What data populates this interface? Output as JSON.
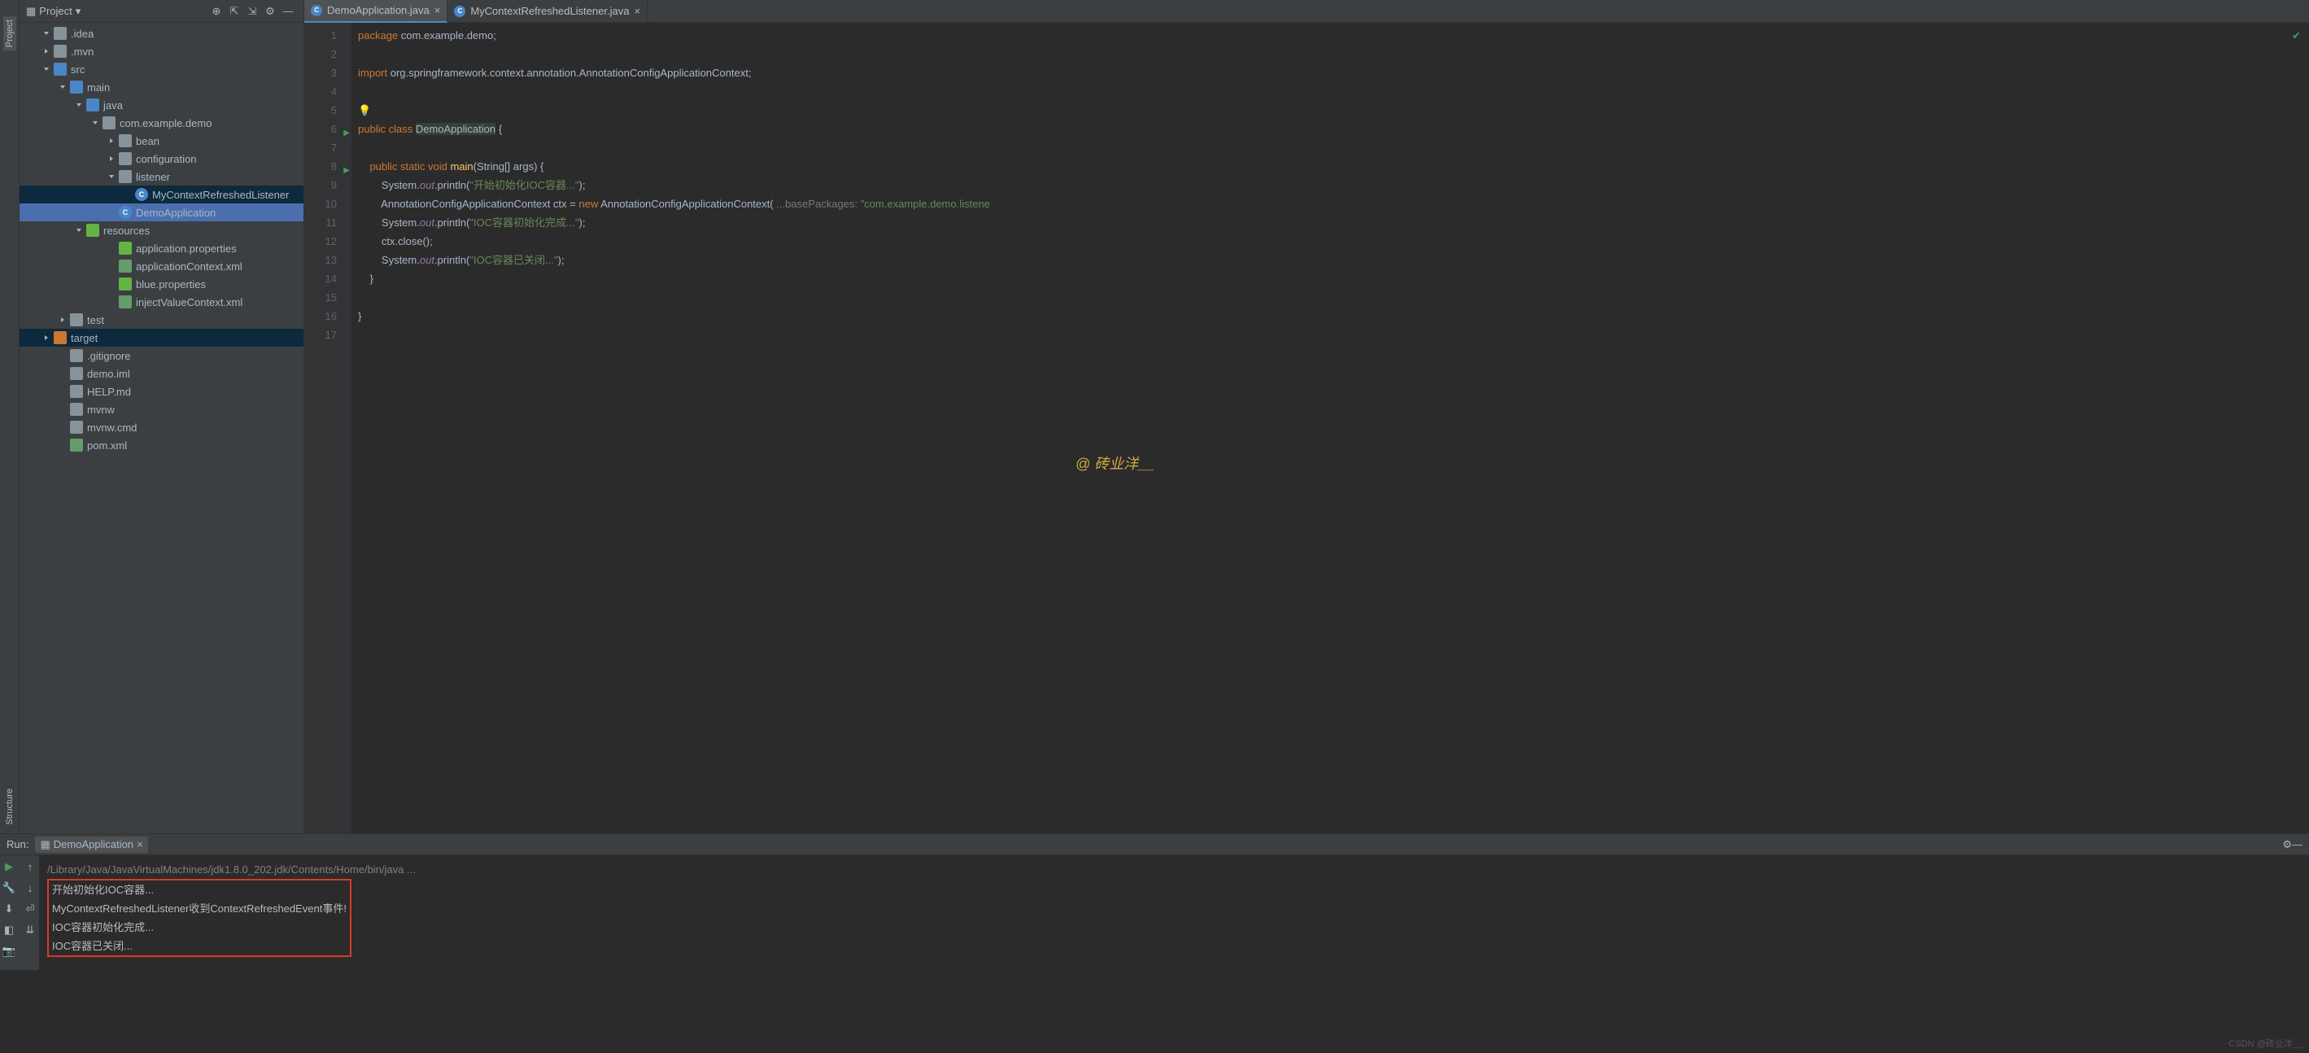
{
  "leftTabs": {
    "project": "Project",
    "structure": "Structure"
  },
  "sidebar": {
    "title": "Project",
    "tree": [
      {
        "indent": 28,
        "chv": "d",
        "ico": "folder",
        "name": ".idea"
      },
      {
        "indent": 28,
        "chv": "r",
        "ico": "folder",
        "name": ".mvn"
      },
      {
        "indent": 28,
        "chv": "d",
        "ico": "folder-src",
        "name": "src"
      },
      {
        "indent": 48,
        "chv": "d",
        "ico": "folder-src",
        "name": "main"
      },
      {
        "indent": 68,
        "chv": "d",
        "ico": "folder-src",
        "name": "java"
      },
      {
        "indent": 88,
        "chv": "d",
        "ico": "folder",
        "name": "com.example.demo"
      },
      {
        "indent": 108,
        "chv": "r",
        "ico": "folder",
        "name": "bean"
      },
      {
        "indent": 108,
        "chv": "r",
        "ico": "folder",
        "name": "configuration"
      },
      {
        "indent": 108,
        "chv": "d",
        "ico": "folder",
        "name": "listener"
      },
      {
        "indent": 128,
        "chv": "",
        "ico": "cls",
        "name": "MyContextRefreshedListener",
        "sel": true
      },
      {
        "indent": 108,
        "chv": "",
        "ico": "cls",
        "name": "DemoApplication",
        "hl": true
      },
      {
        "indent": 68,
        "chv": "d",
        "ico": "folder-res",
        "name": "resources"
      },
      {
        "indent": 108,
        "chv": "",
        "ico": "prop",
        "name": "application.properties"
      },
      {
        "indent": 108,
        "chv": "",
        "ico": "xml",
        "name": "applicationContext.xml"
      },
      {
        "indent": 108,
        "chv": "",
        "ico": "prop",
        "name": "blue.properties"
      },
      {
        "indent": 108,
        "chv": "",
        "ico": "xml",
        "name": "injectValueContext.xml"
      },
      {
        "indent": 48,
        "chv": "r",
        "ico": "folder",
        "name": "test"
      },
      {
        "indent": 28,
        "chv": "r",
        "ico": "folder-tgt",
        "name": "target",
        "sel": true
      },
      {
        "indent": 48,
        "chv": "",
        "ico": "file",
        "name": ".gitignore"
      },
      {
        "indent": 48,
        "chv": "",
        "ico": "file",
        "name": "demo.iml"
      },
      {
        "indent": 48,
        "chv": "",
        "ico": "file",
        "name": "HELP.md"
      },
      {
        "indent": 48,
        "chv": "",
        "ico": "file",
        "name": "mvnw"
      },
      {
        "indent": 48,
        "chv": "",
        "ico": "file",
        "name": "mvnw.cmd"
      },
      {
        "indent": 48,
        "chv": "",
        "ico": "xml",
        "name": "pom.xml"
      }
    ]
  },
  "tabs": [
    {
      "name": "DemoApplication.java",
      "active": true
    },
    {
      "name": "MyContextRefreshedListener.java",
      "active": false
    }
  ],
  "code": {
    "lines": [
      {
        "n": 1,
        "html": "<span class='kw'>package</span> com.example.demo;"
      },
      {
        "n": 2,
        "html": ""
      },
      {
        "n": 3,
        "html": "<span class='kw'>import</span> org.springframework.context.annotation.AnnotationConfigApplicationContext;"
      },
      {
        "n": 4,
        "html": ""
      },
      {
        "n": 5,
        "html": "<span class='bulb'>💡</span>"
      },
      {
        "n": 6,
        "html": "<span class='kw'>public class</span> <span class='bg-cls'>DemoApplication</span> {",
        "run": true
      },
      {
        "n": 7,
        "html": ""
      },
      {
        "n": 8,
        "html": "    <span class='kw'>public static void</span> <span class='id'>main</span>(String[] args) {",
        "run": true
      },
      {
        "n": 9,
        "html": "        System.<span class='fld'>out</span>.println(<span class='str'>\"开始初始化IOC容器...\"</span>);"
      },
      {
        "n": 10,
        "html": "        AnnotationConfigApplicationContext ctx = <span class='kw'>new</span> AnnotationConfigApplicationContext( <span class='hint'>...basePackages:</span> <span class='str'>\"com.example.demo.listene</span>"
      },
      {
        "n": 11,
        "html": "        System.<span class='fld'>out</span>.println(<span class='str'>\"IOC容器初始化完成...\"</span>);"
      },
      {
        "n": 12,
        "html": "        ctx.close();"
      },
      {
        "n": 13,
        "html": "        System.<span class='fld'>out</span>.println(<span class='str'>\"IOC容器已关闭...\"</span>);"
      },
      {
        "n": 14,
        "html": "    }"
      },
      {
        "n": 15,
        "html": ""
      },
      {
        "n": 16,
        "html": "}"
      },
      {
        "n": 17,
        "html": ""
      }
    ]
  },
  "run": {
    "title": "Run:",
    "config": "DemoApplication",
    "cmd": "/Library/Java/JavaVirtualMachines/jdk1.8.0_202.jdk/Contents/Home/bin/java ...",
    "out": [
      "开始初始化IOC容器...",
      "MyContextRefreshedListener收到ContextRefreshedEvent事件!",
      "IOC容器初始化完成...",
      "IOC容器已关闭..."
    ]
  },
  "watermark": "@ 砖业洋__",
  "watermark2": "CSDN @砖业洋__"
}
